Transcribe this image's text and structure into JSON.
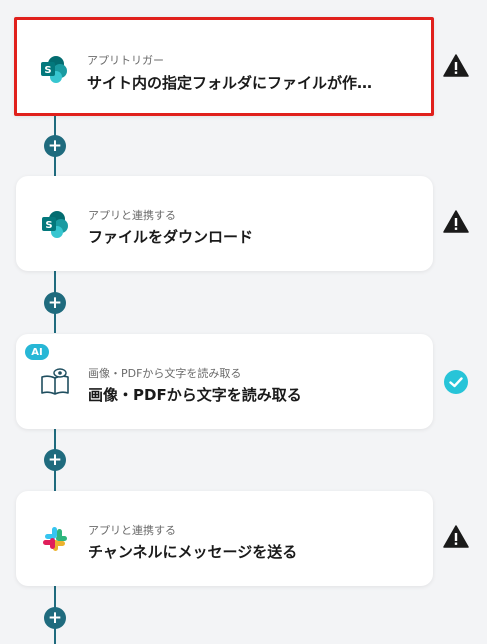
{
  "flow": {
    "steps": [
      {
        "subtitle": "アプリトリガー",
        "title": "サイト内の指定フォルダにファイルが作…",
        "status": "warning",
        "icon": "sharepoint-icon"
      },
      {
        "subtitle": "アプリと連携する",
        "title": "ファイルをダウンロード",
        "status": "warning",
        "icon": "sharepoint-icon"
      },
      {
        "subtitle": "画像・PDFから文字を読み取る",
        "title": "画像・PDFから文字を読み取る",
        "status": "done",
        "icon": "ocr-book-eye-icon",
        "badge": "AI"
      },
      {
        "subtitle": "アプリと連携する",
        "title": "チャンネルにメッセージを送る",
        "status": "warning",
        "icon": "slack-icon"
      }
    ],
    "add_label": "+"
  },
  "colors": {
    "connector": "#1f6b7e",
    "selected_border": "#e0201c",
    "done": "#27c4d8",
    "warning": "#1a1a1a"
  }
}
